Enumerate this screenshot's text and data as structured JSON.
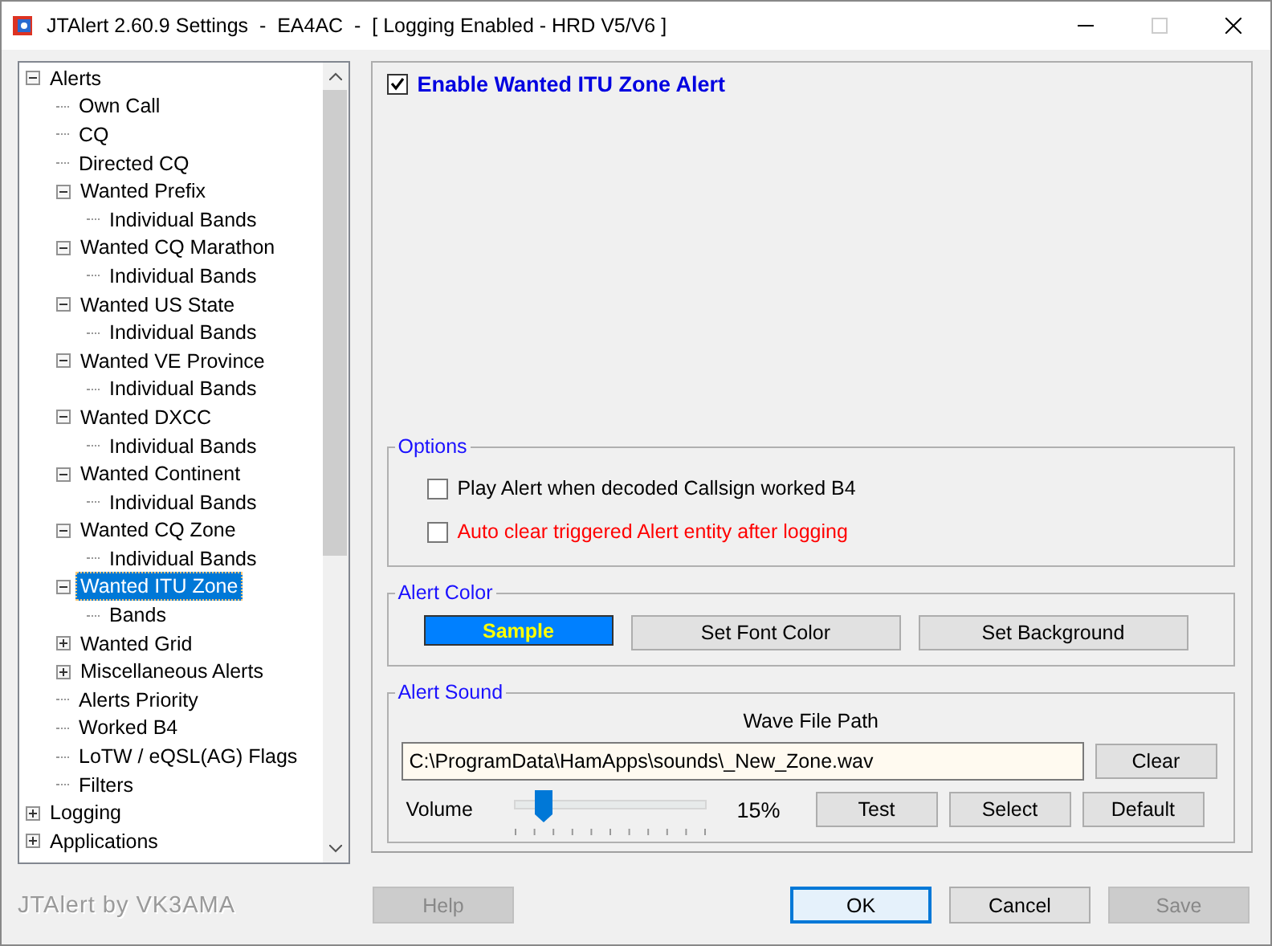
{
  "window": {
    "title": "JTAlert 2.60.9 Settings  -  EA4AC  -  [ Logging Enabled - HRD V5/V6 ]",
    "maximize_disabled": true
  },
  "tree": [
    {
      "label": "Alerts",
      "selected": false,
      "expanded": true,
      "children": [
        {
          "label": "Own Call",
          "selected": false
        },
        {
          "label": "CQ",
          "selected": false
        },
        {
          "label": "Directed CQ",
          "selected": false
        },
        {
          "label": "Wanted Prefix",
          "selected": false,
          "expanded": true,
          "children": [
            {
              "label": "Individual Bands",
              "selected": false
            }
          ]
        },
        {
          "label": "Wanted CQ Marathon",
          "selected": false,
          "expanded": true,
          "children": [
            {
              "label": "Individual Bands",
              "selected": false
            }
          ]
        },
        {
          "label": "Wanted US State",
          "selected": false,
          "expanded": true,
          "children": [
            {
              "label": "Individual Bands",
              "selected": false
            }
          ]
        },
        {
          "label": "Wanted VE Province",
          "selected": false,
          "expanded": true,
          "children": [
            {
              "label": "Individual Bands",
              "selected": false
            }
          ]
        },
        {
          "label": "Wanted DXCC",
          "selected": false,
          "expanded": true,
          "children": [
            {
              "label": "Individual Bands",
              "selected": false
            }
          ]
        },
        {
          "label": "Wanted Continent",
          "selected": false,
          "expanded": true,
          "children": [
            {
              "label": "Individual Bands",
              "selected": false
            }
          ]
        },
        {
          "label": "Wanted CQ Zone",
          "selected": false,
          "expanded": true,
          "children": [
            {
              "label": "Individual Bands",
              "selected": false
            }
          ]
        },
        {
          "label": "Wanted ITU Zone",
          "selected": true,
          "expanded": true,
          "children": [
            {
              "label": "Bands",
              "selected": false
            }
          ]
        },
        {
          "label": "Wanted Grid",
          "selected": false,
          "expanded": false
        },
        {
          "label": "Miscellaneous Alerts",
          "selected": false,
          "expanded": false
        },
        {
          "label": "Alerts Priority",
          "selected": false
        },
        {
          "label": "Worked B4",
          "selected": false
        },
        {
          "label": "LoTW / eQSL(AG) Flags",
          "selected": false
        },
        {
          "label": "Filters",
          "selected": false
        }
      ]
    },
    {
      "label": "Logging",
      "selected": false,
      "expanded": false
    },
    {
      "label": "Applications",
      "selected": false,
      "expanded": false
    }
  ],
  "footer_brand": "JTAlert by VK3AMA",
  "enable": {
    "label": "Enable Wanted ITU Zone Alert",
    "checked": true
  },
  "options": {
    "title": "Options",
    "items": [
      {
        "label": "Play Alert when decoded Callsign worked B4",
        "checked": false,
        "color": "#000000"
      },
      {
        "label": "Auto clear triggered Alert entity after logging",
        "checked": false,
        "color": "#ff0000"
      }
    ]
  },
  "alert_color": {
    "title": "Alert Color",
    "sample": {
      "label": "Sample"
    },
    "buttons": [
      "Set Font Color",
      "Set Background"
    ]
  },
  "alert_sound": {
    "title": "Alert Sound",
    "path_label": "Wave File Path",
    "path": "C:\\ProgramData\\HamApps\\sounds\\_New_Zone.wav",
    "clear_button": "Clear",
    "volume_label": "Volume",
    "volume": {
      "level": 0.15,
      "reading": "15%"
    },
    "buttons": [
      "Test",
      "Select",
      "Default"
    ]
  },
  "dialog_buttons": [
    {
      "label": "Help",
      "disabled": true,
      "default": false
    },
    {
      "label": "OK",
      "disabled": false,
      "default": true
    },
    {
      "label": "Cancel",
      "disabled": false,
      "default": false
    },
    {
      "label": "Save",
      "disabled": true,
      "default": false
    }
  ]
}
